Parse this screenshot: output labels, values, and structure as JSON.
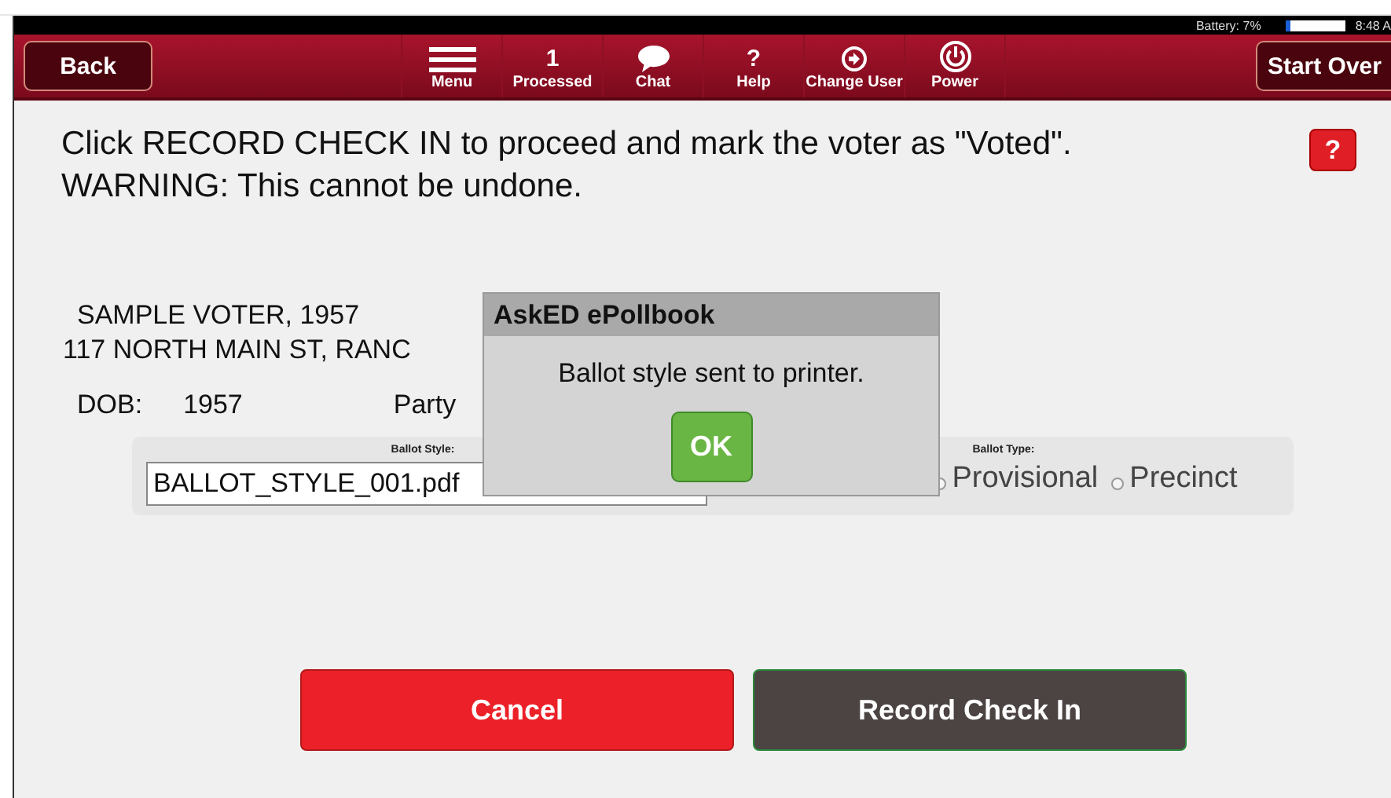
{
  "status_bar": {
    "battery_label": "Battery: 7%",
    "battery": {
      "level": 0.07
    },
    "time": "8:48 A"
  },
  "toolbar": {
    "back": "Back",
    "start_over": "Start Over",
    "items": [
      {
        "kind": "menu",
        "label": "Menu"
      },
      {
        "kind": "count",
        "count": "1",
        "label": "Processed"
      },
      {
        "kind": "chat",
        "label": "Chat"
      },
      {
        "kind": "glyph",
        "glyph": "?",
        "label": "Help"
      },
      {
        "kind": "user",
        "label": "Change User"
      },
      {
        "kind": "power",
        "label": "Power"
      }
    ]
  },
  "instruction": "Click RECORD CHECK IN to proceed and mark the voter as \"Voted\".\nWARNING: This cannot be undone.",
  "help_button": "?",
  "voter": {
    "name": "SAMPLE VOTER, 1957",
    "address": "117 NORTH MAIN ST, RANC",
    "dob_label": "DOB:",
    "dob": "1957",
    "party_label": "Party"
  },
  "ballot_style": {
    "label": "Ballot Style:",
    "value": "BALLOT_STYLE_001.pdf"
  },
  "ballot_type": {
    "label": "Ballot Type:",
    "options": [
      {
        "label": "Provisional",
        "selected": false
      },
      {
        "label": "Precinct",
        "selected": false
      }
    ]
  },
  "buttons": [
    {
      "kind": "cancel",
      "label": "Cancel"
    },
    {
      "kind": "record",
      "label": "Record Check In"
    }
  ],
  "dialog": {
    "title": "AskED ePollbook",
    "message": "Ballot style sent to printer.",
    "button": "OK"
  }
}
